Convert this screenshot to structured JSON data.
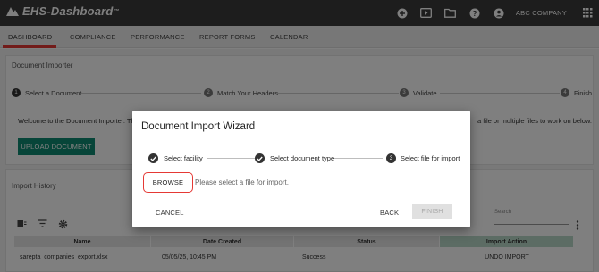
{
  "app": {
    "name": "EHS-Dashboard",
    "trademark": "™",
    "company": "ABC COMPANY"
  },
  "header_icons": [
    "add-icon",
    "media-icon",
    "folder-icon",
    "help-icon",
    "account-icon",
    "apps-grid-icon"
  ],
  "nav": {
    "tabs": [
      "DASHBOARD",
      "COMPLIANCE",
      "PERFORMANCE",
      "REPORT FORMS",
      "CALENDAR"
    ],
    "active_index": 0
  },
  "importer": {
    "title": "Document Importer",
    "steps": [
      {
        "num": "1",
        "label": "Select a Document"
      },
      {
        "num": "2",
        "label": "Match Your Headers"
      },
      {
        "num": "3",
        "label": "Validate"
      },
      {
        "num": "4",
        "label": "Finish"
      }
    ],
    "welcome_text": "Welcome to the Document Importer. This",
    "welcome_text_right": "a file or multiple files to work on below.",
    "upload_label": "UPLOAD DOCUMENT"
  },
  "history": {
    "title": "Import History",
    "search_label": "Search",
    "columns": [
      "Name",
      "Date Created",
      "Status",
      "Import Action"
    ],
    "rows": [
      {
        "name": "sarepta_companies_export.xlsx",
        "date": "05/05/25, 10:45 PM",
        "status": "Success",
        "action": "UNDO IMPORT"
      }
    ]
  },
  "wizard": {
    "title": "Document Import Wizard",
    "steps": [
      {
        "label": "Select facility",
        "state": "done"
      },
      {
        "label": "Select document type",
        "state": "done"
      },
      {
        "label": "Select file for import",
        "state": "current",
        "num": "3"
      }
    ],
    "browse_label": "BROWSE",
    "browse_hint": "Please select a file for import.",
    "cancel_label": "CANCEL",
    "back_label": "BACK",
    "finish_label": "FINISH"
  },
  "colors": {
    "header": "#3a3a3a",
    "accent_red": "#e53935",
    "primary_green": "#0e8a72"
  }
}
